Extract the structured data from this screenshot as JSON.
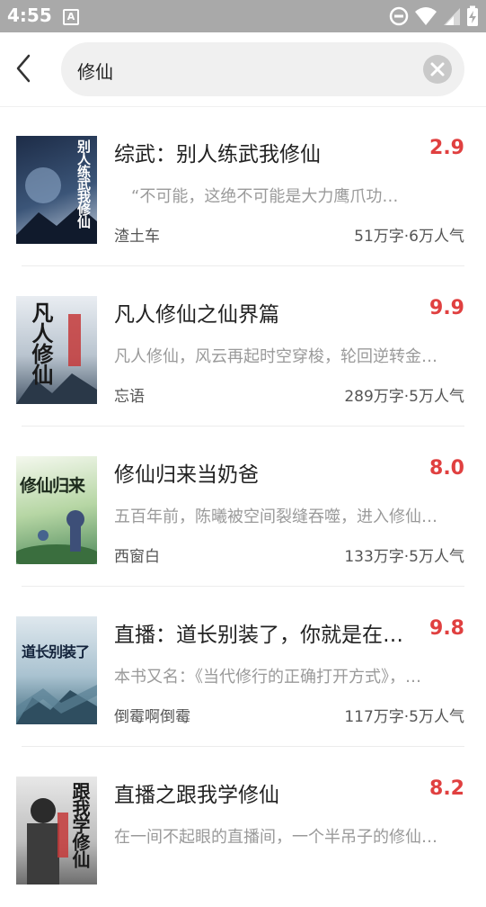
{
  "status_bar": {
    "time": "4:55",
    "notification_letter": "A"
  },
  "search": {
    "query": "修仙"
  },
  "books": [
    {
      "title": "综武：别人练武我修仙",
      "score": "2.9",
      "description": "“不可能，这绝不可能是大力鹰爪功…",
      "author": "渣土车",
      "meta": "51万字·6万人气",
      "cover_text": "别人练武我修仙",
      "cover_color": "#2c3e5c"
    },
    {
      "title": "凡人修仙之仙界篇",
      "score": "9.9",
      "description": "凡人修仙，风云再起时空穿梭，轮回逆转金…",
      "author": "忘语",
      "meta": "289万字·5万人气",
      "cover_text": "凡人修仙",
      "cover_color": "#5a6a7a"
    },
    {
      "title": "修仙归来当奶爸",
      "score": "8.0",
      "description": "五百年前，陈曦被空间裂缝吞噬，进入修仙…",
      "author": "西窗白",
      "meta": "133万字·5万人气",
      "cover_text": "修仙归来",
      "cover_color": "#6aa36a"
    },
    {
      "title": "直播：道长别装了，你就是在…",
      "score": "9.8",
      "description": "本书又名：《当代修行的正确打开方式》，…",
      "author": "倒霉啊倒霉",
      "meta": "117万字·5万人气",
      "cover_text": "道长别装了",
      "cover_color": "#4a6f86"
    },
    {
      "title": "直播之跟我学修仙",
      "score": "8.2",
      "description": "在一间不起眼的直播间，一个半吊子的修仙…",
      "author": "",
      "meta": "",
      "cover_text": "跟我学修仙",
      "cover_color": "#8a8a8a"
    }
  ]
}
